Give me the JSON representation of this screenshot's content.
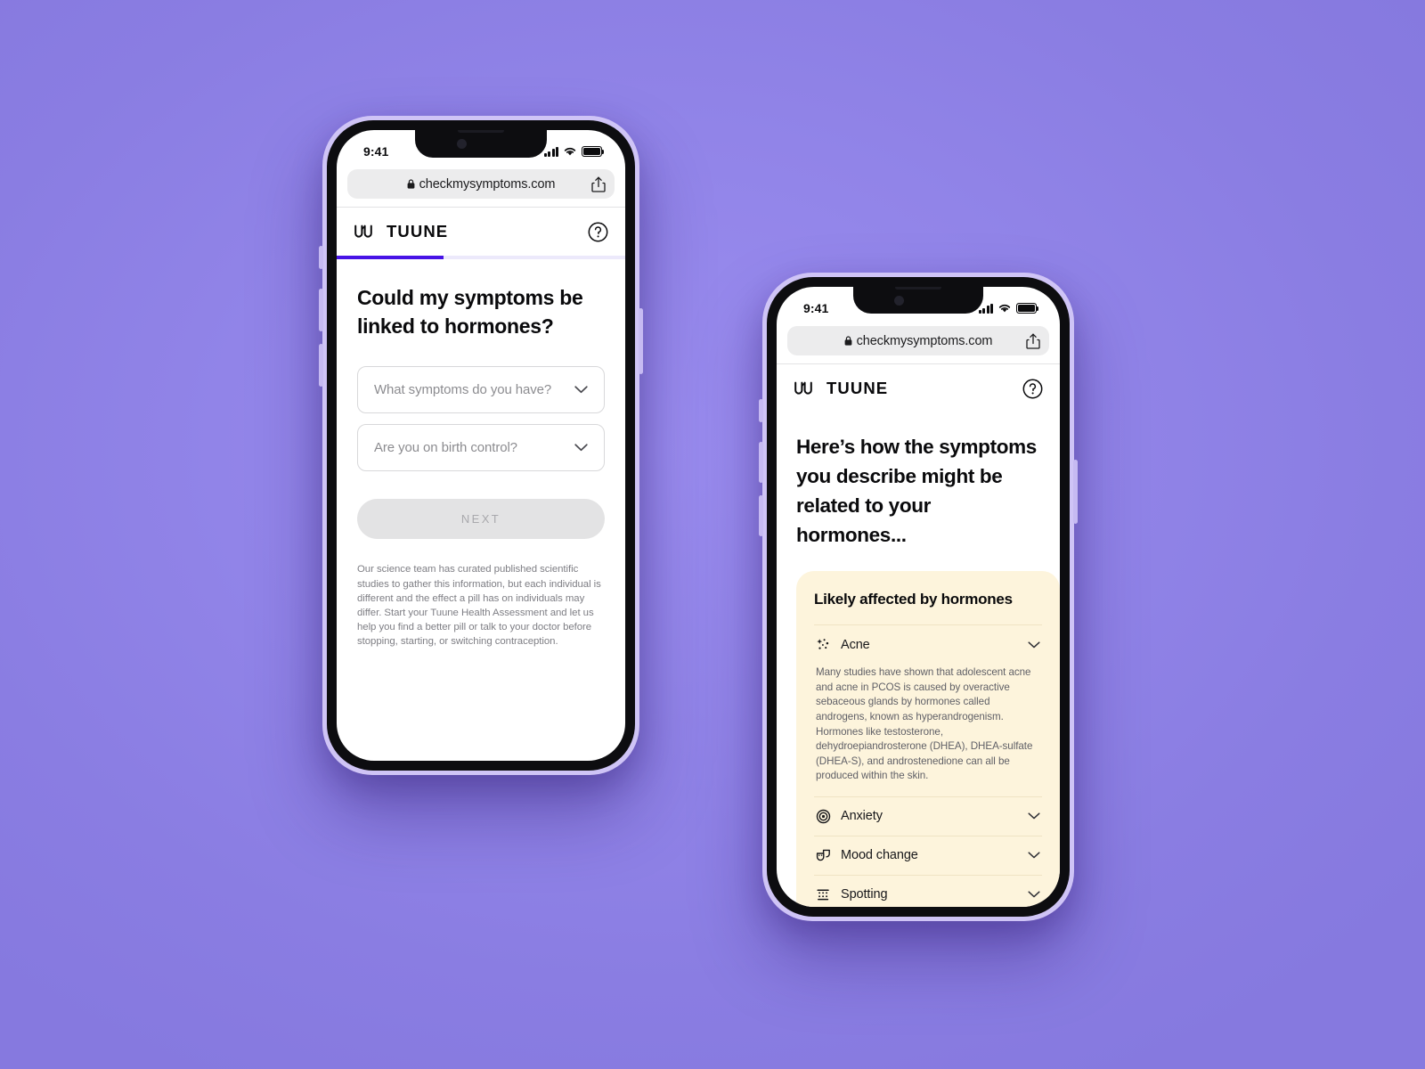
{
  "background_color": "#9184E8",
  "phones": {
    "left": {
      "status": {
        "time": "9:41",
        "signal_icon": "cellular-bars-icon",
        "wifi_icon": "wifi-icon",
        "battery_icon": "battery-full-icon"
      },
      "browser": {
        "url": "checkmysymptoms.com",
        "lock_icon": "lock-icon",
        "share_icon": "share-icon"
      },
      "appbar": {
        "logo_icon": "tuune-logo-icon",
        "brand": "TUUNE",
        "help_icon": "help-circle-icon"
      },
      "progress": {
        "percent": 37,
        "fill_color": "#4713e6",
        "track_color": "#ece9fb"
      },
      "page": {
        "title": "Could my symptoms be linked to hormones?",
        "fields": [
          {
            "placeholder": "What symptoms do you have?",
            "value": "",
            "chevron_icon": "chevron-down-icon"
          },
          {
            "placeholder": "Are you on birth control?",
            "value": "",
            "chevron_icon": "chevron-down-icon"
          }
        ],
        "next_label": "NEXT",
        "next_enabled": false,
        "disclaimer": "Our science team has curated published scientific studies to gather this information, but each individual is different and the effect a pill has on individuals may differ. Start your Tuune Health Assessment and let us help you find a better pill or talk to your doctor before stopping, starting, or switching contraception."
      }
    },
    "right": {
      "status": {
        "time": "9:41",
        "signal_icon": "cellular-bars-icon",
        "wifi_icon": "wifi-icon",
        "battery_icon": "battery-full-icon"
      },
      "browser": {
        "url": "checkmysymptoms.com",
        "lock_icon": "lock-icon",
        "share_icon": "share-icon"
      },
      "appbar": {
        "logo_icon": "tuune-logo-icon",
        "brand": "TUUNE",
        "help_icon": "help-circle-icon"
      },
      "page": {
        "title": "Here’s how the symptoms you describe might be related to your hormones...",
        "card": {
          "background_color": "#FDF4DC",
          "title": "Likely affected by hormones",
          "symptoms": [
            {
              "label": "Acne",
              "icon": "acne-sparkle-icon",
              "expanded": true,
              "chevron_icon": "chevron-down-icon",
              "body": "Many studies have shown that adolescent acne and acne in PCOS is caused by overactive sebaceous glands by hormones called androgens, known as hyperandrogenism. Hormones like testosterone, dehydroepiandrosterone (DHEA), DHEA-sulfate (DHEA-S), and androstenedione can all be produced within the skin."
            },
            {
              "label": "Anxiety",
              "icon": "anxiety-spiral-icon",
              "expanded": false,
              "chevron_icon": "chevron-down-icon",
              "body": ""
            },
            {
              "label": "Mood change",
              "icon": "mood-masks-icon",
              "expanded": false,
              "chevron_icon": "chevron-down-icon",
              "body": ""
            },
            {
              "label": "Spotting",
              "icon": "spotting-dots-icon",
              "expanded": false,
              "chevron_icon": "chevron-down-icon",
              "body": ""
            }
          ]
        }
      }
    }
  }
}
